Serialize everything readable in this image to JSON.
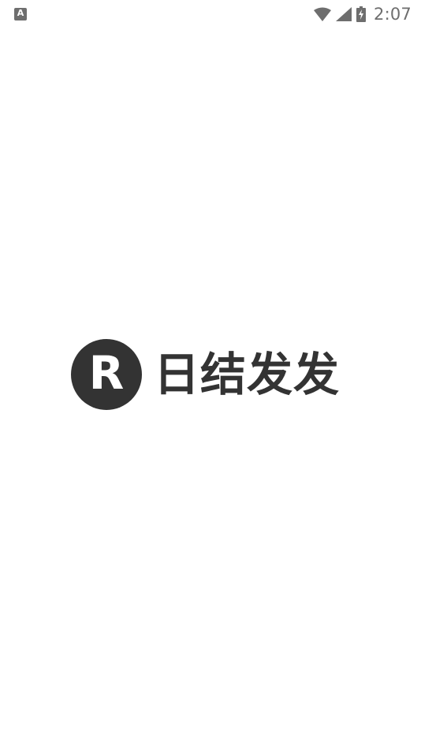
{
  "status_bar": {
    "notification_icon": "A",
    "icons": [
      "wifi-icon",
      "cell-signal-icon",
      "battery-charging-icon"
    ],
    "time": "2:07"
  },
  "splash": {
    "logo_letter": "R",
    "app_name": "日结发发"
  },
  "colors": {
    "background": "#ffffff",
    "logo": "#333333",
    "status_icons": "#6e6e6e"
  }
}
